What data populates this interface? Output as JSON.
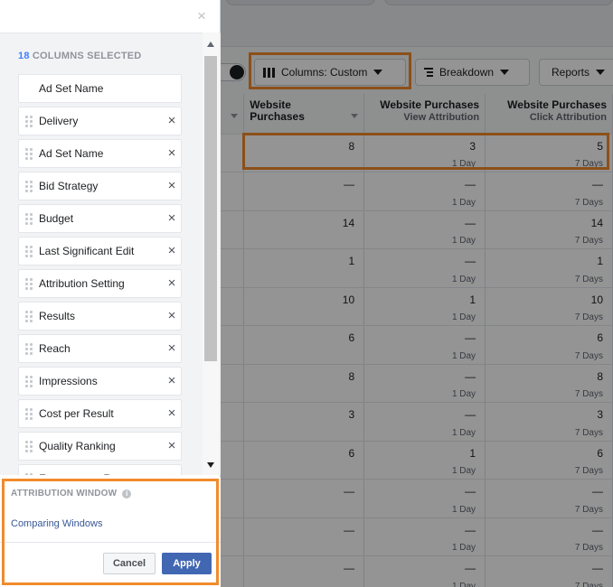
{
  "dialog": {
    "selected_count": "18",
    "selected_label": "COLUMNS SELECTED",
    "close_glyph": "×",
    "columns": [
      {
        "label": "Ad Set Name",
        "removable": false
      },
      {
        "label": "Delivery",
        "removable": true
      },
      {
        "label": "Ad Set Name",
        "removable": true
      },
      {
        "label": "Bid Strategy",
        "removable": true
      },
      {
        "label": "Budget",
        "removable": true
      },
      {
        "label": "Last Significant Edit",
        "removable": true
      },
      {
        "label": "Attribution Setting",
        "removable": true
      },
      {
        "label": "Results",
        "removable": true
      },
      {
        "label": "Reach",
        "removable": true
      },
      {
        "label": "Impressions",
        "removable": true
      },
      {
        "label": "Cost per Result",
        "removable": true
      },
      {
        "label": "Quality Ranking",
        "removable": true
      },
      {
        "label": "Engagement Rate",
        "removable": true
      }
    ],
    "remove_glyph": "×",
    "attribution": {
      "title": "ATTRIBUTION WINDOW",
      "link": "Comparing Windows"
    },
    "cancel_label": "Cancel",
    "apply_label": "Apply"
  },
  "toolbar": {
    "columns_label": "Columns: Custom",
    "breakdown_label": "Breakdown",
    "reports_label": "Reports"
  },
  "table": {
    "headers": [
      {
        "title": "Website Purchases",
        "sub": ""
      },
      {
        "title": "Website Purchases",
        "sub": "View Attribution"
      },
      {
        "title": "Website Purchases",
        "sub": "Click Attribution"
      }
    ],
    "rows": [
      {
        "total": "8",
        "view": "3",
        "view_window": "1 Day",
        "click": "5",
        "click_window": "7 Days"
      },
      {
        "total": "—",
        "view": "—",
        "view_window": "1 Day",
        "click": "—",
        "click_window": "7 Days"
      },
      {
        "total": "14",
        "view": "—",
        "view_window": "1 Day",
        "click": "14",
        "click_window": "7 Days"
      },
      {
        "total": "1",
        "view": "—",
        "view_window": "1 Day",
        "click": "1",
        "click_window": "7 Days"
      },
      {
        "total": "10",
        "view": "1",
        "view_window": "1 Day",
        "click": "10",
        "click_window": "7 Days"
      },
      {
        "total": "6",
        "view": "—",
        "view_window": "1 Day",
        "click": "6",
        "click_window": "7 Days"
      },
      {
        "total": "8",
        "view": "—",
        "view_window": "1 Day",
        "click": "8",
        "click_window": "7 Days"
      },
      {
        "total": "3",
        "view": "—",
        "view_window": "1 Day",
        "click": "3",
        "click_window": "7 Days"
      },
      {
        "total": "6",
        "view": "1",
        "view_window": "1 Day",
        "click": "6",
        "click_window": "7 Days"
      },
      {
        "total": "—",
        "view": "—",
        "view_window": "1 Day",
        "click": "—",
        "click_window": "7 Days"
      },
      {
        "total": "—",
        "view": "—",
        "view_window": "1 Day",
        "click": "—",
        "click_window": "7 Days"
      },
      {
        "total": "—",
        "view": "—",
        "view_window": "1 Day",
        "click": "—",
        "click_window": "7 Days"
      }
    ]
  },
  "colors": {
    "highlight": "#f28b2c",
    "accent": "#4267b2",
    "link": "#385898"
  }
}
